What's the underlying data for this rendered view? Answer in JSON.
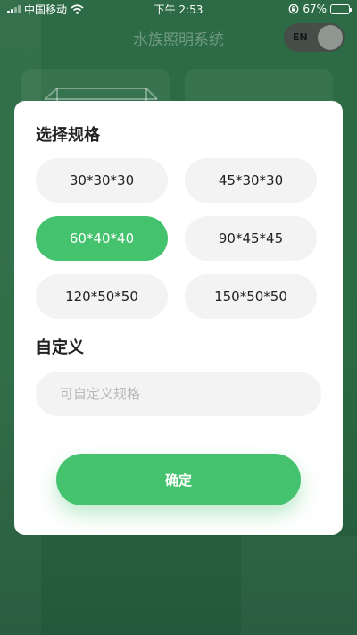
{
  "status_bar": {
    "carrier": "中国移动",
    "time": "下午 2:53",
    "battery_percent": "67%",
    "battery_level": 0.67,
    "wifi_icon": "wifi-icon",
    "rotation_lock_icon": "rotation-lock-icon"
  },
  "header": {
    "title": "水族照明系统",
    "lang_toggle_label": "EN"
  },
  "modal": {
    "spec_section_title": "选择规格",
    "specs": [
      {
        "label": "30*30*30",
        "selected": false
      },
      {
        "label": "45*30*30",
        "selected": false
      },
      {
        "label": "60*40*40",
        "selected": true
      },
      {
        "label": "90*45*45",
        "selected": false
      },
      {
        "label": "120*50*50",
        "selected": false
      },
      {
        "label": "150*50*50",
        "selected": false
      }
    ],
    "custom_section_title": "自定义",
    "custom_input": {
      "value": "",
      "placeholder": "可自定义规格"
    },
    "confirm_label": "确定"
  },
  "colors": {
    "accent": "#45c26e",
    "background_overlay": "#2c6b45",
    "chip_bg": "#f3f3f3"
  }
}
